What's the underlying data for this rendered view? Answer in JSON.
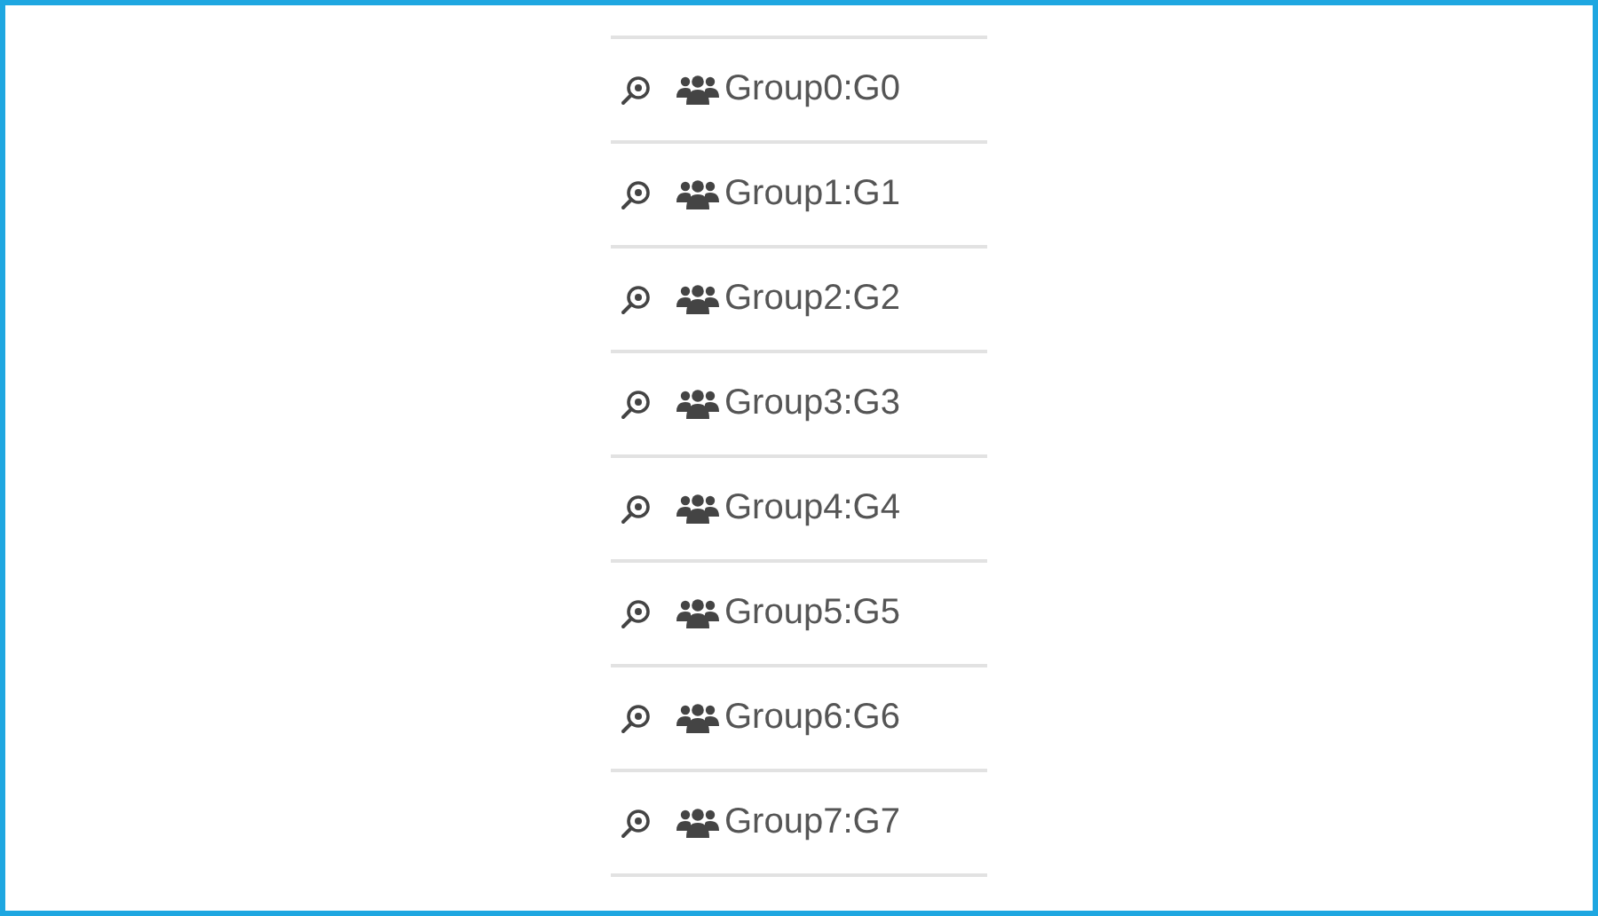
{
  "groups": [
    {
      "label": "Group0:G0"
    },
    {
      "label": "Group1:G1"
    },
    {
      "label": "Group2:G2"
    },
    {
      "label": "Group3:G3"
    },
    {
      "label": "Group4:G4"
    },
    {
      "label": "Group5:G5"
    },
    {
      "label": "Group6:G6"
    },
    {
      "label": "Group7:G7"
    }
  ]
}
